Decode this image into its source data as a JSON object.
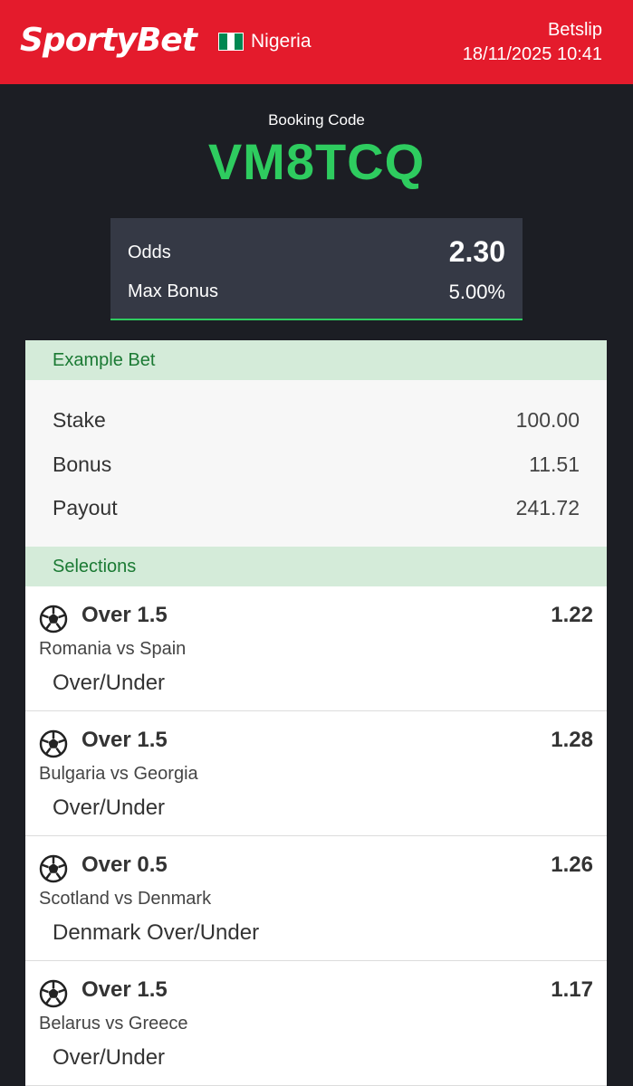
{
  "header": {
    "brand": "SportyBet",
    "country": "Nigeria",
    "betslip": "Betslip",
    "datetime": "18/11/2025 10:41",
    "flag_colors": [
      "#008751",
      "#ffffff",
      "#008751"
    ]
  },
  "booking": {
    "label": "Booking Code",
    "code": "VM8TCQ"
  },
  "summary": {
    "odds_label": "Odds",
    "odds_value": "2.30",
    "bonus_label": "Max Bonus",
    "bonus_value": "5.00%"
  },
  "example": {
    "title": "Example Bet",
    "rows": [
      {
        "label": "Stake",
        "value": "100.00"
      },
      {
        "label": "Bonus",
        "value": "11.51"
      },
      {
        "label": "Payout",
        "value": "241.72"
      }
    ]
  },
  "selections": {
    "title": "Selections",
    "items": [
      {
        "icon": "soccer-ball-icon",
        "pick": "Over 1.5",
        "odd": "1.22",
        "match": "Romania vs Spain",
        "market": "Over/Under"
      },
      {
        "icon": "soccer-ball-icon",
        "pick": "Over 1.5",
        "odd": "1.28",
        "match": "Bulgaria vs Georgia",
        "market": "Over/Under"
      },
      {
        "icon": "soccer-ball-icon",
        "pick": "Over 0.5",
        "odd": "1.26",
        "match": "Scotland vs Denmark",
        "market": "Denmark Over/Under"
      },
      {
        "icon": "soccer-ball-icon",
        "pick": "Over 1.5",
        "odd": "1.17",
        "match": "Belarus vs Greece",
        "market": "Over/Under"
      }
    ]
  },
  "colors": {
    "brand_red": "#e41b2c",
    "accent_green": "#2ecc5f",
    "section_green": "#1b7a34"
  }
}
